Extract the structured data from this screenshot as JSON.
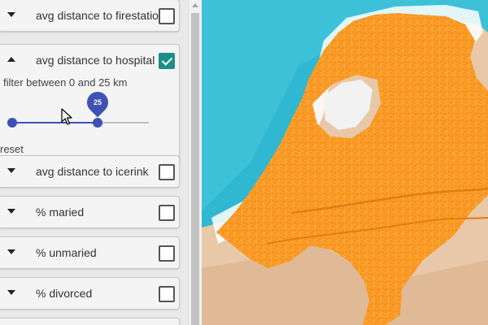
{
  "sidebar": {
    "panels": [
      {
        "label": "avg distance to firestation",
        "expanded": false,
        "checked": false
      },
      {
        "label": "avg distance to hospital",
        "expanded": true,
        "checked": true,
        "filter": {
          "text": "filter between 0 and 25 km",
          "min": 0,
          "max": 25,
          "value": 25,
          "value_label": "25",
          "reset_label": "reset"
        }
      },
      {
        "label": "avg distance to icerink",
        "expanded": false,
        "checked": false
      },
      {
        "label": "% maried",
        "expanded": false,
        "checked": false
      },
      {
        "label": "% unmaried",
        "expanded": false,
        "checked": false
      },
      {
        "label": "% divorced",
        "expanded": false,
        "checked": false
      }
    ]
  },
  "map": {
    "region_color": "#f7941d",
    "sea_color": "#30b8d2",
    "land_color": "#e8c8a8"
  },
  "icons": {
    "collapse": "triangle-down",
    "expand": "triangle-up",
    "checkbox": "checkbox",
    "pointer": "mouse-pointer"
  }
}
